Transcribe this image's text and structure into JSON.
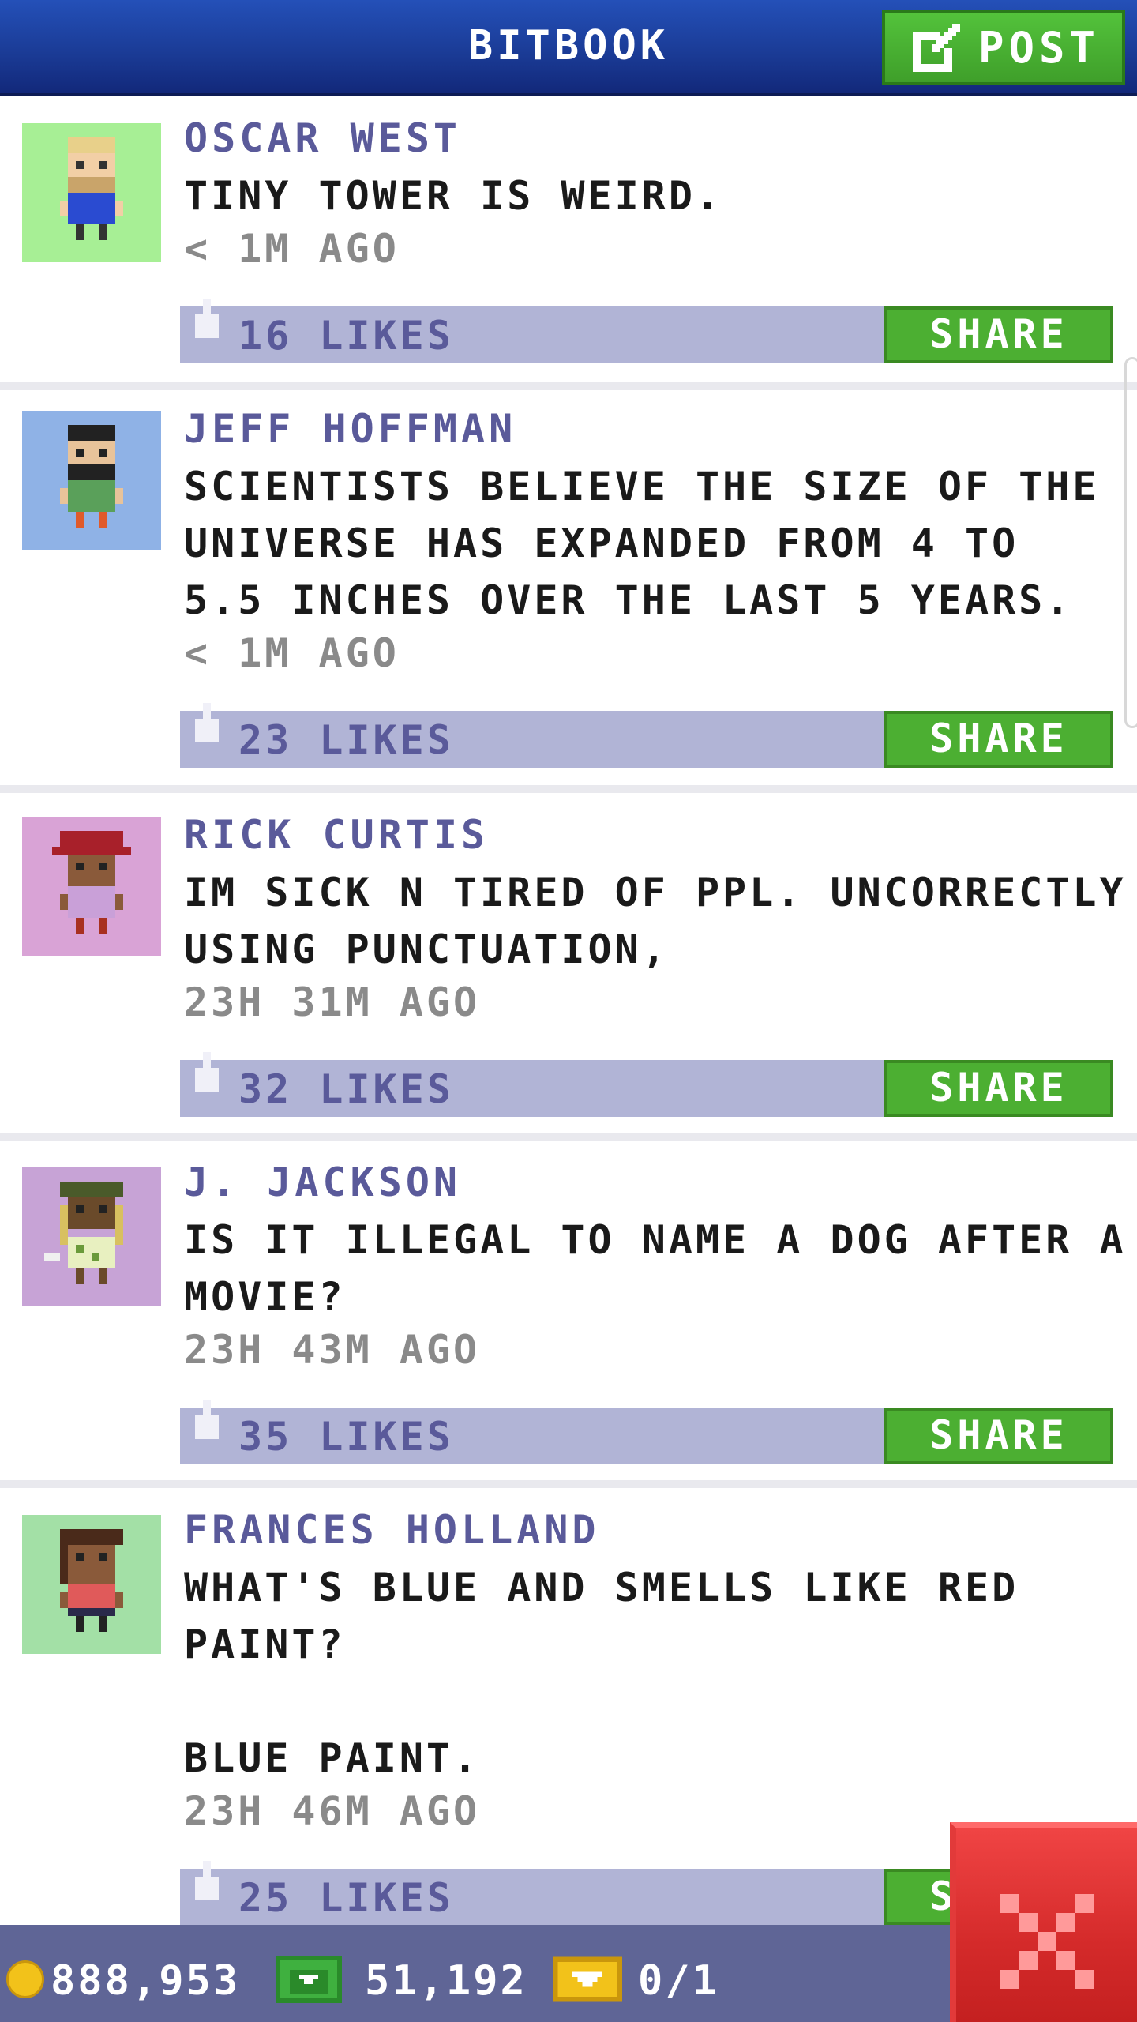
{
  "header": {
    "title": "BITBOOK",
    "post_label": "POST"
  },
  "posts": [
    {
      "name": "OSCAR WEST",
      "message": "TINY TOWER IS WEIRD.",
      "time": "< 1M AGO",
      "likes": "16 LIKES",
      "share_label": "SHARE",
      "avatar_bg": "#a7ef95"
    },
    {
      "name": "JEFF HOFFMAN",
      "message": "SCIENTISTS BELIEVE THE SIZE OF THE\nUNIVERSE HAS EXPANDED FROM 4 TO\n5.5 INCHES OVER THE LAST 5 YEARS.",
      "time": "< 1M AGO",
      "likes": "23 LIKES",
      "share_label": "SHARE",
      "avatar_bg": "#8fb2e6"
    },
    {
      "name": "RICK CURTIS",
      "message": "IM SICK N TIRED OF PPL. UNCORRECTLY\nUSING PUNCTUATION,",
      "time": "23H 31M AGO",
      "likes": "32 LIKES",
      "share_label": "SHARE",
      "avatar_bg": "#d9a3d6"
    },
    {
      "name": "J. JACKSON",
      "message": "IS IT ILLEGAL TO NAME A DOG AFTER A\nMOVIE?",
      "time": "23H 43M AGO",
      "likes": "35 LIKES",
      "share_label": "SHARE",
      "avatar_bg": "#c7a3d6"
    },
    {
      "name": "FRANCES HOLLAND",
      "message": "WHAT'S BLUE AND SMELLS LIKE RED\nPAINT?\n\nBLUE PAINT.",
      "time": "23H 46M AGO",
      "likes": "25 LIKES",
      "share_label": "SHARE",
      "avatar_bg": "#a3e0a6"
    }
  ],
  "footer": {
    "coins": "888,953",
    "bux": "51,192",
    "tickets": "0/1"
  },
  "colors": {
    "header": "#1a3a94",
    "share": "#4caf32",
    "likebar": "#b1b4d6",
    "close": "#d42a2a"
  }
}
